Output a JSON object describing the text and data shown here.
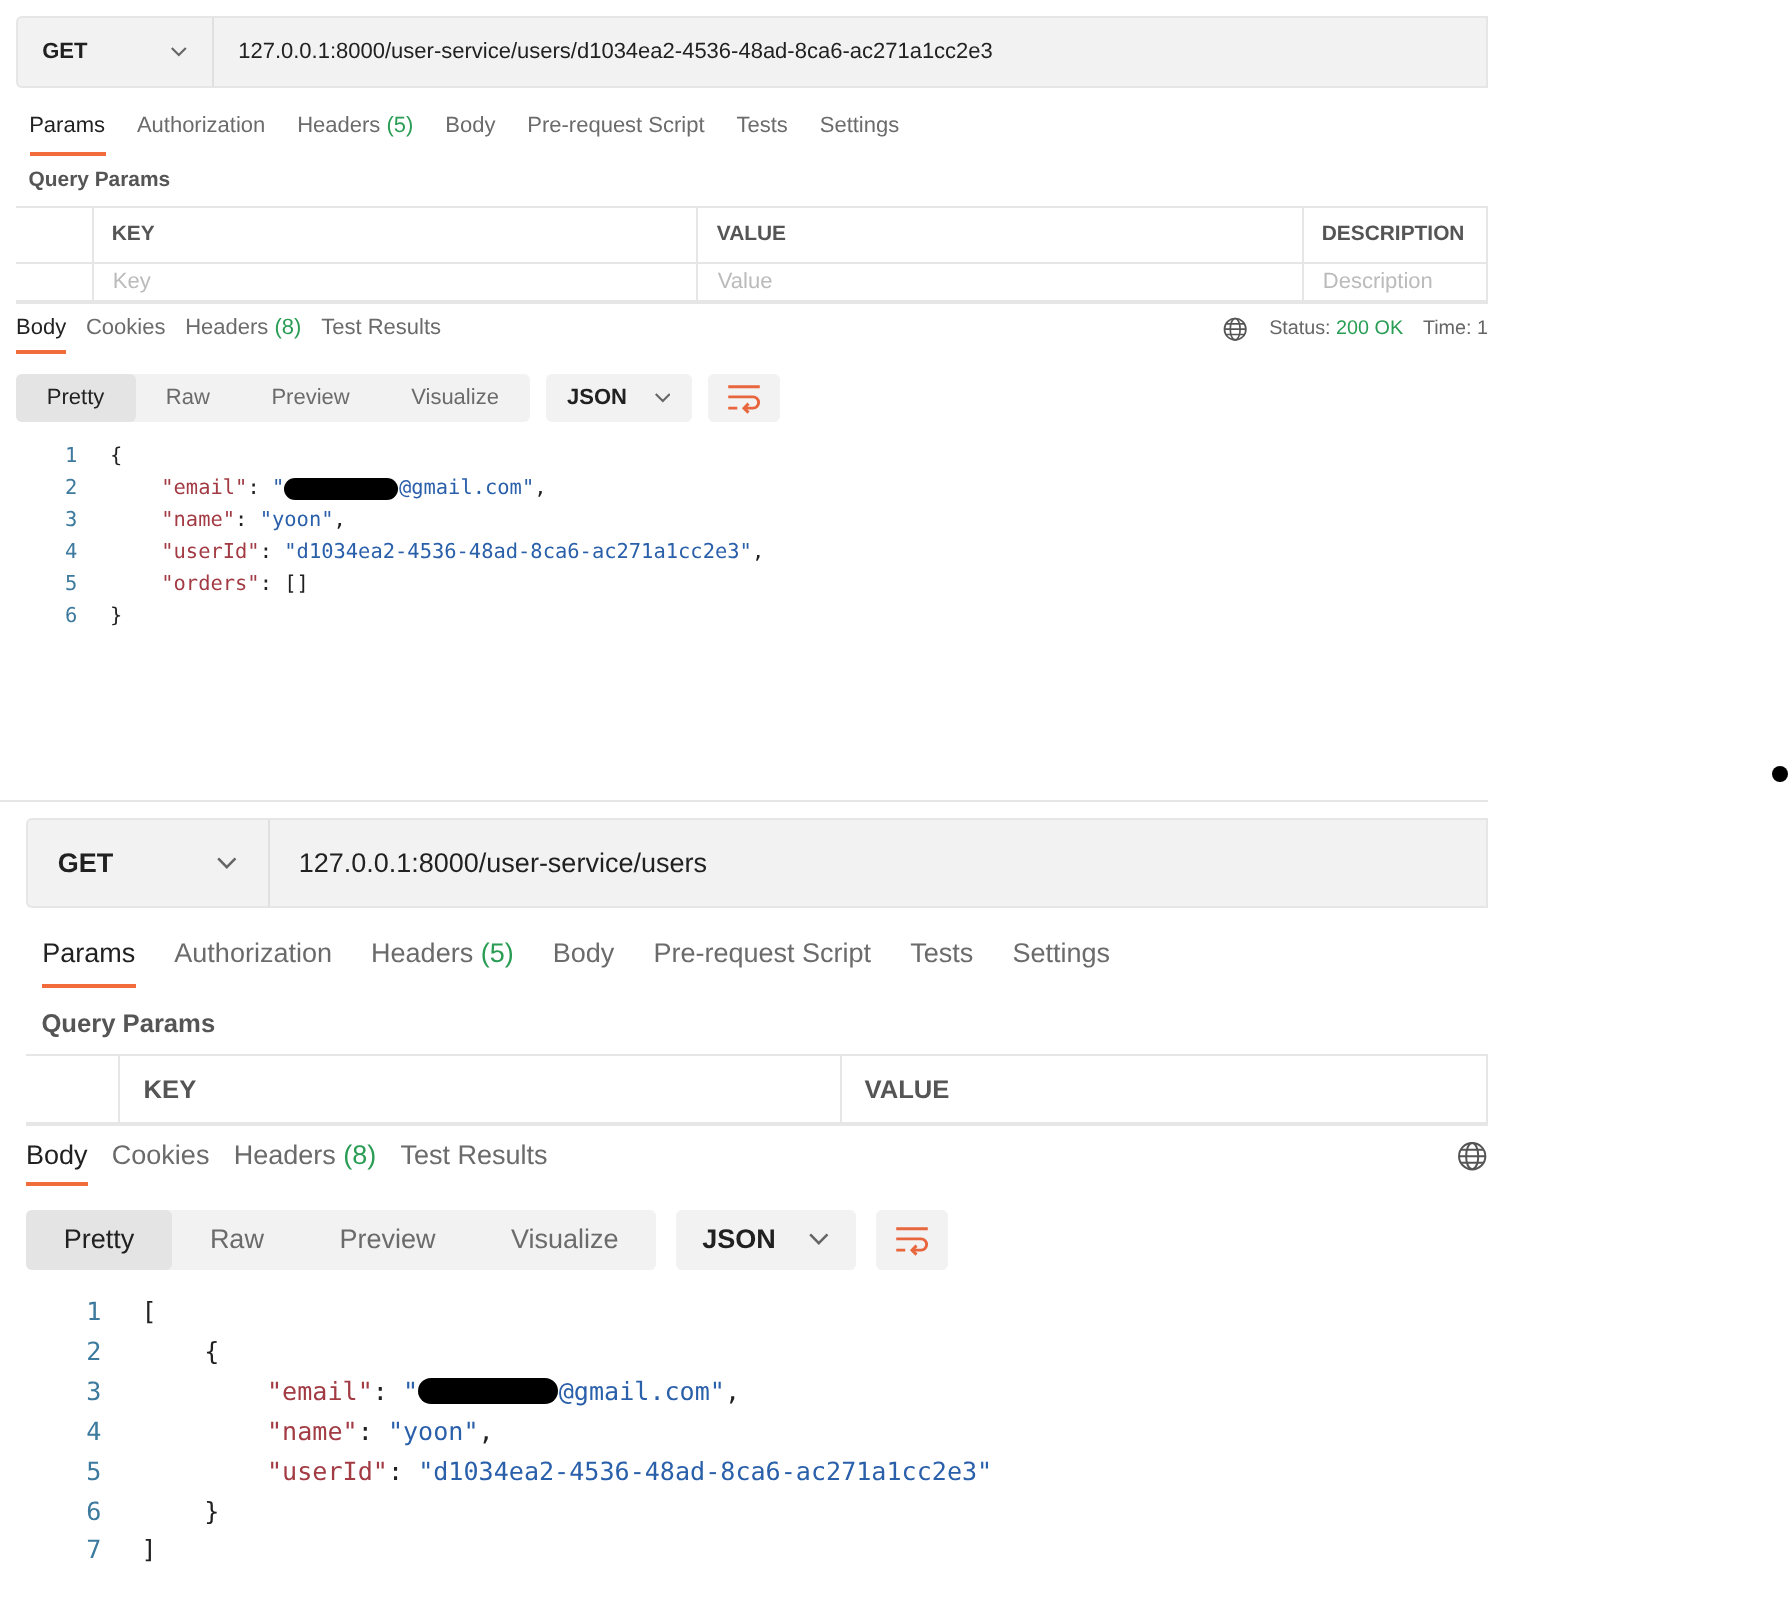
{
  "panels": [
    {
      "request": {
        "method": "GET",
        "url": "127.0.0.1:8000/user-service/users/d1034ea2-4536-48ad-8ca6-ac271a1cc2e3"
      },
      "request_tabs": [
        {
          "label": "Params",
          "selected": true
        },
        {
          "label": "Authorization",
          "selected": false
        },
        {
          "label": "Headers",
          "count": "(5)",
          "selected": false
        },
        {
          "label": "Body",
          "selected": false
        },
        {
          "label": "Pre-request Script",
          "selected": false
        },
        {
          "label": "Tests",
          "selected": false
        },
        {
          "label": "Settings",
          "selected": false
        }
      ],
      "section_title": "Query Params",
      "params_table": {
        "columns": [
          "KEY",
          "VALUE",
          "DESCRIPTION"
        ],
        "placeholders": [
          "Key",
          "Value",
          "Description"
        ]
      },
      "response_tabs": [
        {
          "label": "Body",
          "selected": true
        },
        {
          "label": "Cookies",
          "selected": false
        },
        {
          "label": "Headers",
          "count": "(8)",
          "selected": false
        },
        {
          "label": "Test Results",
          "selected": false
        }
      ],
      "status": {
        "label": "Status:",
        "value": "200 OK"
      },
      "time": "Time: 1",
      "view_modes": [
        {
          "label": "Pretty",
          "selected": true
        },
        {
          "label": "Raw",
          "selected": false
        },
        {
          "label": "Preview",
          "selected": false
        },
        {
          "label": "Visualize",
          "selected": false
        }
      ],
      "format": "JSON",
      "code_lines": [
        {
          "number": "1",
          "tokens": [
            {
              "kind": "punct",
              "text": "{"
            }
          ]
        },
        {
          "number": "2",
          "tokens": [
            {
              "kind": "key",
              "text": "\"email\""
            },
            {
              "kind": "punct",
              "text": ":"
            },
            {
              "kind": "string",
              "text": "\""
            },
            {
              "kind": "redacted"
            },
            {
              "kind": "string",
              "text": "@gmail.com\""
            },
            {
              "kind": "punct",
              "text": ","
            }
          ]
        },
        {
          "number": "3",
          "tokens": [
            {
              "kind": "key",
              "text": "\"name\""
            },
            {
              "kind": "punct",
              "text": ":"
            },
            {
              "kind": "string",
              "text": "\"yoon\""
            },
            {
              "kind": "punct",
              "text": ","
            }
          ]
        },
        {
          "number": "4",
          "tokens": [
            {
              "kind": "key",
              "text": "\"userId\""
            },
            {
              "kind": "punct",
              "text": ":"
            },
            {
              "kind": "string",
              "text": "\"d1034ea2-4536-48ad-8ca6-ac271a1cc2e3\""
            },
            {
              "kind": "punct",
              "text": ","
            }
          ]
        },
        {
          "number": "5",
          "tokens": [
            {
              "kind": "key",
              "text": "\"orders\""
            },
            {
              "kind": "punct",
              "text": ":"
            },
            {
              "kind": "punct",
              "text": "[]"
            }
          ]
        },
        {
          "number": "6",
          "tokens": [
            {
              "kind": "punct",
              "text": "}"
            }
          ]
        }
      ]
    },
    {
      "request": {
        "method": "GET",
        "url": "127.0.0.1:8000/user-service/users"
      },
      "request_tabs": [
        {
          "label": "Params",
          "selected": true
        },
        {
          "label": "Authorization",
          "selected": false
        },
        {
          "label": "Headers",
          "count": "(5)",
          "selected": false
        },
        {
          "label": "Body",
          "selected": false
        },
        {
          "label": "Pre-request Script",
          "selected": false
        },
        {
          "label": "Tests",
          "selected": false
        },
        {
          "label": "Settings",
          "selected": false
        }
      ],
      "section_title": "Query Params",
      "params_table": {
        "columns": [
          "KEY",
          "VALUE"
        ]
      },
      "response_tabs": [
        {
          "label": "Body",
          "selected": true
        },
        {
          "label": "Cookies",
          "selected": false
        },
        {
          "label": "Headers",
          "count": "(8)",
          "selected": false
        },
        {
          "label": "Test Results",
          "selected": false
        }
      ],
      "view_modes": [
        {
          "label": "Pretty",
          "selected": true
        },
        {
          "label": "Raw",
          "selected": false
        },
        {
          "label": "Preview",
          "selected": false
        },
        {
          "label": "Visualize",
          "selected": false
        }
      ],
      "format": "JSON",
      "code_lines": [
        {
          "number": "1",
          "tokens": [
            {
              "kind": "punct",
              "text": "["
            }
          ]
        },
        {
          "number": "2",
          "tokens": [
            {
              "kind": "punct",
              "text": "{"
            }
          ]
        },
        {
          "number": "3",
          "tokens": [
            {
              "kind": "key",
              "text": "\"email\""
            },
            {
              "kind": "punct",
              "text": ":"
            },
            {
              "kind": "string",
              "text": "\""
            },
            {
              "kind": "redacted"
            },
            {
              "kind": "string",
              "text": "@gmail.com\""
            },
            {
              "kind": "punct",
              "text": ","
            }
          ]
        },
        {
          "number": "4",
          "tokens": [
            {
              "kind": "key",
              "text": "\"name\""
            },
            {
              "kind": "punct",
              "text": ":"
            },
            {
              "kind": "string",
              "text": "\"yoon\""
            },
            {
              "kind": "punct",
              "text": ","
            }
          ]
        },
        {
          "number": "5",
          "tokens": [
            {
              "kind": "key",
              "text": "\"userId\""
            },
            {
              "kind": "punct",
              "text": ":"
            },
            {
              "kind": "string",
              "text": "\"d1034ea2-4536-48ad-8ca6-ac271a1cc2e3\""
            }
          ]
        },
        {
          "number": "6",
          "tokens": [
            {
              "kind": "punct",
              "text": "}"
            }
          ]
        },
        {
          "number": "7",
          "tokens": [
            {
              "kind": "punct",
              "text": "]"
            }
          ]
        }
      ]
    }
  ]
}
